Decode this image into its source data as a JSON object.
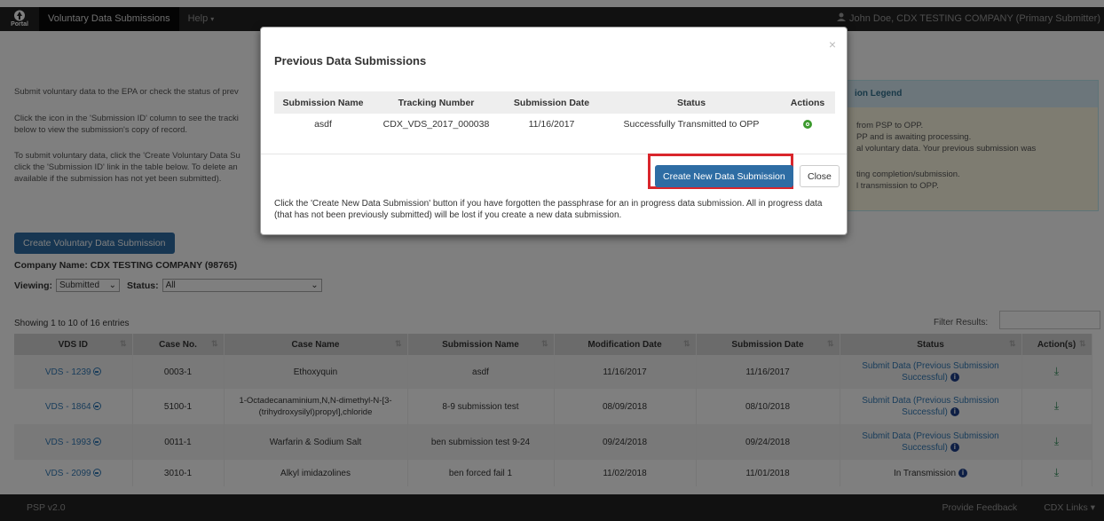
{
  "nav": {
    "logo_text": "Portal",
    "menu_item": "Voluntary Data Submissions",
    "help": "Help",
    "user": "John Doe, CDX TESTING COMPANY (Primary Submitter)"
  },
  "intro": {
    "line1": "Submit voluntary data to the EPA or check the status of prev",
    "line2": "Click the icon in the 'Submission ID' column to see the tracki",
    "line3": "below to view the submission's copy of record.",
    "line4": "To submit voluntary data, click the 'Create Voluntary Data Su",
    "line5": "click the 'Submission ID' link in the table below. To delete an",
    "line6": "available if the submission has not yet been submitted)."
  },
  "legend": {
    "title": "ion Legend",
    "line1": "from PSP to OPP.",
    "line2": "PP and is awaiting processing.",
    "line3": "al voluntary data. Your previous submission was",
    "line4": "ting completion/submission.",
    "line5": "l transmission to OPP."
  },
  "create_button": "Create Voluntary Data Submission",
  "company": "Company Name: CDX TESTING COMPANY (98765)",
  "filters": {
    "viewing_label": "Viewing:",
    "viewing_value": "Submitted",
    "status_label": "Status:",
    "status_value": "All"
  },
  "showing": "Showing 1 to 10 of 16 entries",
  "filter_label": "Filter Results:",
  "table": {
    "headers": [
      "VDS ID",
      "Case No.",
      "Case Name",
      "Submission Name",
      "Modification Date",
      "Submission Date",
      "Status",
      "Action(s)"
    ],
    "rows": [
      {
        "vds": "VDS - 1239",
        "case_no": "0003-1",
        "case_name": "Ethoxyquin",
        "sub_name": "asdf",
        "mod_date": "11/16/2017",
        "sub_date": "11/16/2017",
        "status": "Submit Data (Previous Submission Successful)"
      },
      {
        "vds": "VDS - 1864",
        "case_no": "5100-1",
        "case_name": "1-Octadecanaminium,N,N-dimethyl-N-[3-(trihydroxysilyl)propyl],chloride",
        "sub_name": "8-9 submission test",
        "mod_date": "08/09/2018",
        "sub_date": "08/10/2018",
        "status": "Submit Data (Previous Submission Successful)"
      },
      {
        "vds": "VDS - 1993",
        "case_no": "0011-1",
        "case_name": "Warfarin & Sodium Salt",
        "sub_name": "ben submission test 9-24",
        "mod_date": "09/24/2018",
        "sub_date": "09/24/2018",
        "status": "Submit Data (Previous Submission Successful)"
      },
      {
        "vds": "VDS - 2099",
        "case_no": "3010-1",
        "case_name": "Alkyl imidazolines",
        "sub_name": "ben forced fail 1",
        "mod_date": "11/02/2018",
        "sub_date": "11/01/2018",
        "status": "In Transmission"
      }
    ]
  },
  "footer": {
    "version": "PSP v2.0",
    "feedback": "Provide Feedback",
    "links": "CDX Links"
  },
  "modal": {
    "title": "Previous Data Submissions",
    "close_x": "×",
    "headers": [
      "Submission Name",
      "Tracking Number",
      "Submission Date",
      "Status",
      "Actions"
    ],
    "row": {
      "name": "asdf",
      "tracking": "CDX_VDS_2017_000038",
      "date": "11/16/2017",
      "status": "Successfully Transmitted to OPP"
    },
    "create_button": "Create New Data Submission",
    "close_button": "Close",
    "note": "Click the 'Create New Data Submission' button if you have forgotten the passphrase for an in progress data submission. All in progress data (that has not been previously submitted) will be lost if you create a new data submission."
  }
}
